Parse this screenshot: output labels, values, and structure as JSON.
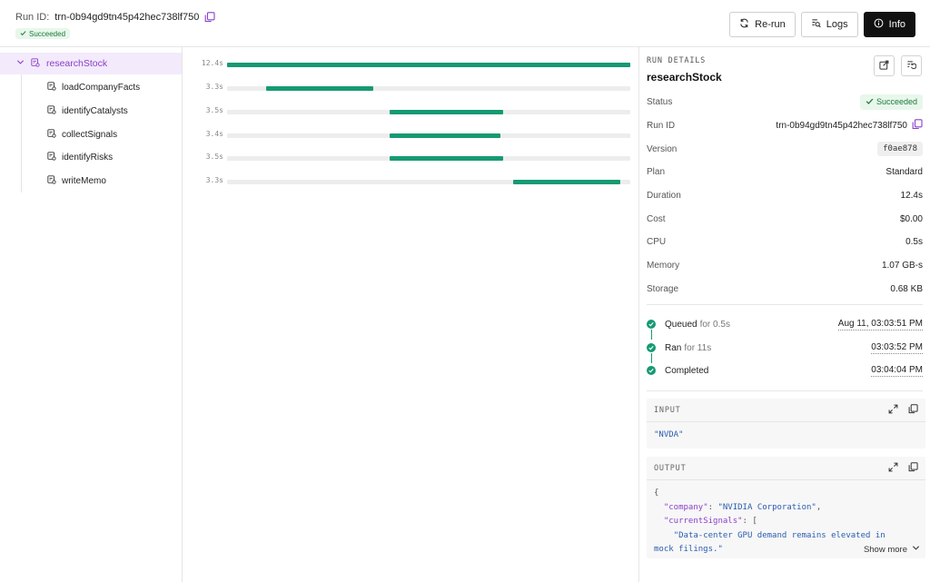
{
  "header": {
    "run_label": "Run ID:",
    "run_id": "trn-0b94gd9tn45p42hec738lf750",
    "status": "Succeeded",
    "buttons": {
      "rerun": "Re-run",
      "logs": "Logs",
      "info": "Info"
    }
  },
  "tree": {
    "root": {
      "label": "researchStock"
    },
    "children": [
      {
        "label": "loadCompanyFacts"
      },
      {
        "label": "identifyCatalysts"
      },
      {
        "label": "collectSignals"
      },
      {
        "label": "identifyRisks"
      },
      {
        "label": "writeMemo"
      }
    ]
  },
  "timeline": {
    "total_seconds": 12.4,
    "rows": [
      {
        "duration": "12.4s",
        "start": 0.0,
        "end": 12.4
      },
      {
        "duration": "3.3s",
        "start": 1.2,
        "end": 4.5
      },
      {
        "duration": "3.5s",
        "start": 5.0,
        "end": 8.5
      },
      {
        "duration": "3.4s",
        "start": 5.0,
        "end": 8.4
      },
      {
        "duration": "3.5s",
        "start": 5.0,
        "end": 8.5
      },
      {
        "duration": "3.3s",
        "start": 8.8,
        "end": 12.1
      }
    ],
    "bar_color": "#169a73"
  },
  "details": {
    "section_label": "RUN DETAILS",
    "title": "researchStock",
    "fields": {
      "status": {
        "label": "Status",
        "value": "Succeeded"
      },
      "run_id": {
        "label": "Run ID",
        "value": "trn-0b94gd9tn45p42hec738lf750"
      },
      "version": {
        "label": "Version",
        "value": "f0ae878"
      },
      "plan": {
        "label": "Plan",
        "value": "Standard"
      },
      "duration": {
        "label": "Duration",
        "value": "12.4s"
      },
      "cost": {
        "label": "Cost",
        "value": "$0.00"
      },
      "cpu": {
        "label": "CPU",
        "value": "0.5s"
      },
      "memory": {
        "label": "Memory",
        "value": "1.07 GB-s"
      },
      "storage": {
        "label": "Storage",
        "value": "0.68 KB"
      }
    },
    "events": [
      {
        "name": "Queued",
        "sub": "for 0.5s",
        "time": "Aug 11, 03:03:51 PM"
      },
      {
        "name": "Ran",
        "sub": "for 11s",
        "time": "03:03:52 PM"
      },
      {
        "name": "Completed",
        "sub": "",
        "time": "03:04:04 PM"
      }
    ],
    "input": {
      "label": "INPUT",
      "value": "\"NVDA\""
    },
    "output": {
      "label": "OUTPUT",
      "open_brace": "{",
      "key1": "\"company\"",
      "colon": ": ",
      "val1": "\"NVIDIA Corporation\"",
      "comma": ",",
      "key2": "\"currentSignals\"",
      "bracket": "[",
      "val2a": "\"Data-center GPU demand remains elevated in",
      "val2b": "mock filings.\"",
      "show_more": "Show more"
    }
  }
}
